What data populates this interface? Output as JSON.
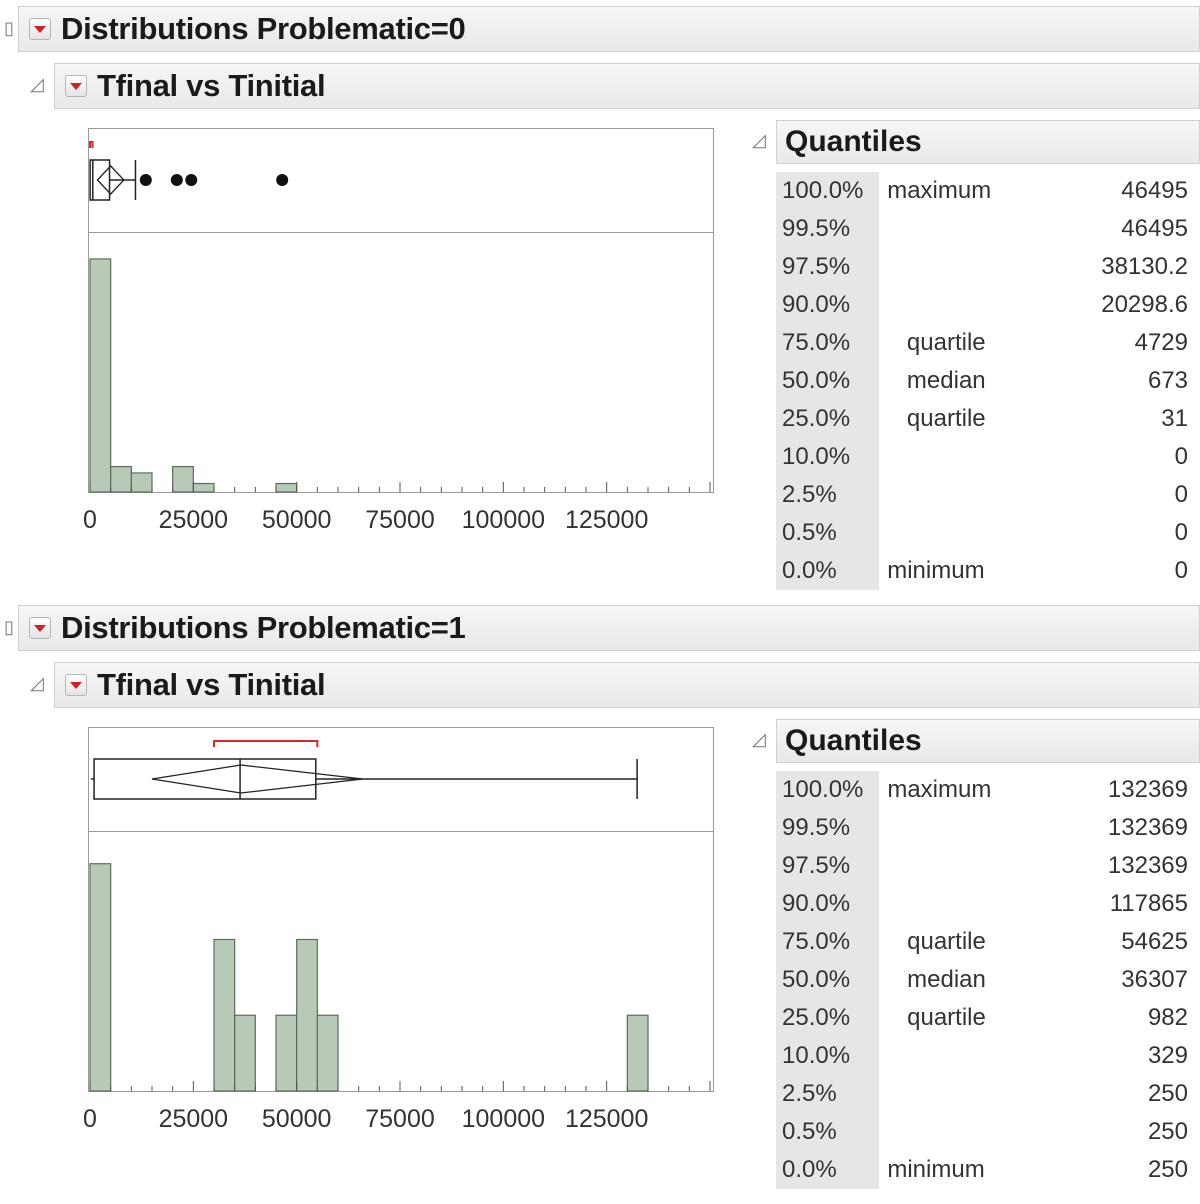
{
  "colors": {
    "bar_fill": "#b9c9b7",
    "bar_stroke": "#5c6e5a",
    "red_bracket": "#d9262b"
  },
  "sections": [
    {
      "heading": "Distributions Problematic=0",
      "subheading": "Tfinal vs Tinitial",
      "quantiles_title": "Quantiles",
      "axis_ticks": [
        "0",
        "25000",
        "50000",
        "75000",
        "100000",
        "125000"
      ],
      "quantiles": [
        {
          "pct": "100.0%",
          "label": "maximum",
          "value": "46495"
        },
        {
          "pct": "99.5%",
          "label": "",
          "value": "46495"
        },
        {
          "pct": "97.5%",
          "label": "",
          "value": "38130.2"
        },
        {
          "pct": "90.0%",
          "label": "",
          "value": "20298.6"
        },
        {
          "pct": "75.0%",
          "label": "quartile",
          "value": "4729"
        },
        {
          "pct": "50.0%",
          "label": "median",
          "value": "673"
        },
        {
          "pct": "25.0%",
          "label": "quartile",
          "value": "31"
        },
        {
          "pct": "10.0%",
          "label": "",
          "value": "0"
        },
        {
          "pct": "2.5%",
          "label": "",
          "value": "0"
        },
        {
          "pct": "0.5%",
          "label": "",
          "value": "0"
        },
        {
          "pct": "0.0%",
          "label": "minimum",
          "value": "0"
        }
      ],
      "chart_data": {
        "type": "bar",
        "xlim": [
          0,
          150000
        ],
        "bin_width": 5000,
        "bins": [
          {
            "x0": 0,
            "x1": 5000,
            "count": 11
          },
          {
            "x0": 5000,
            "x1": 10000,
            "count": 1.2
          },
          {
            "x0": 10000,
            "x1": 15000,
            "count": 0.9
          },
          {
            "x0": 20000,
            "x1": 25000,
            "count": 1.2
          },
          {
            "x0": 25000,
            "x1": 30000,
            "count": 0.4
          },
          {
            "x0": 45000,
            "x1": 50000,
            "count": 0.4
          }
        ],
        "ymax": 11.8,
        "box": {
          "q1": 31,
          "median": 673,
          "q3": 4729,
          "whisker_low": 0,
          "whisker_high": 11000,
          "mean": 5000,
          "mean_ci": [
            1800,
            8200
          ],
          "shortest_half": [
            0,
            600
          ],
          "outliers": [
            13500,
            21000,
            24500,
            46495
          ]
        }
      }
    },
    {
      "heading": "Distributions Problematic=1",
      "subheading": "Tfinal vs Tinitial",
      "quantiles_title": "Quantiles",
      "axis_ticks": [
        "0",
        "25000",
        "50000",
        "75000",
        "100000",
        "125000"
      ],
      "quantiles": [
        {
          "pct": "100.0%",
          "label": "maximum",
          "value": "132369"
        },
        {
          "pct": "99.5%",
          "label": "",
          "value": "132369"
        },
        {
          "pct": "97.5%",
          "label": "",
          "value": "132369"
        },
        {
          "pct": "90.0%",
          "label": "",
          "value": "117865"
        },
        {
          "pct": "75.0%",
          "label": "quartile",
          "value": "54625"
        },
        {
          "pct": "50.0%",
          "label": "median",
          "value": "36307"
        },
        {
          "pct": "25.0%",
          "label": "quartile",
          "value": "982"
        },
        {
          "pct": "10.0%",
          "label": "",
          "value": "329"
        },
        {
          "pct": "2.5%",
          "label": "",
          "value": "250"
        },
        {
          "pct": "0.5%",
          "label": "",
          "value": "250"
        },
        {
          "pct": "0.0%",
          "label": "minimum",
          "value": "250"
        }
      ],
      "chart_data": {
        "type": "bar",
        "xlim": [
          0,
          150000
        ],
        "bin_width": 5000,
        "bins": [
          {
            "x0": 0,
            "x1": 5000,
            "count": 3
          },
          {
            "x0": 30000,
            "x1": 35000,
            "count": 2
          },
          {
            "x0": 35000,
            "x1": 40000,
            "count": 1
          },
          {
            "x0": 45000,
            "x1": 50000,
            "count": 1
          },
          {
            "x0": 50000,
            "x1": 55000,
            "count": 2
          },
          {
            "x0": 55000,
            "x1": 60000,
            "count": 1
          },
          {
            "x0": 130000,
            "x1": 135000,
            "count": 1
          }
        ],
        "ymax": 3.3,
        "box": {
          "q1": 982,
          "median": 36307,
          "q3": 54625,
          "whisker_low": 250,
          "whisker_high": 132369,
          "mean": 36500,
          "mean_ci": [
            15000,
            66000
          ],
          "shortest_half": [
            30000,
            55000
          ],
          "outliers": []
        }
      }
    }
  ]
}
